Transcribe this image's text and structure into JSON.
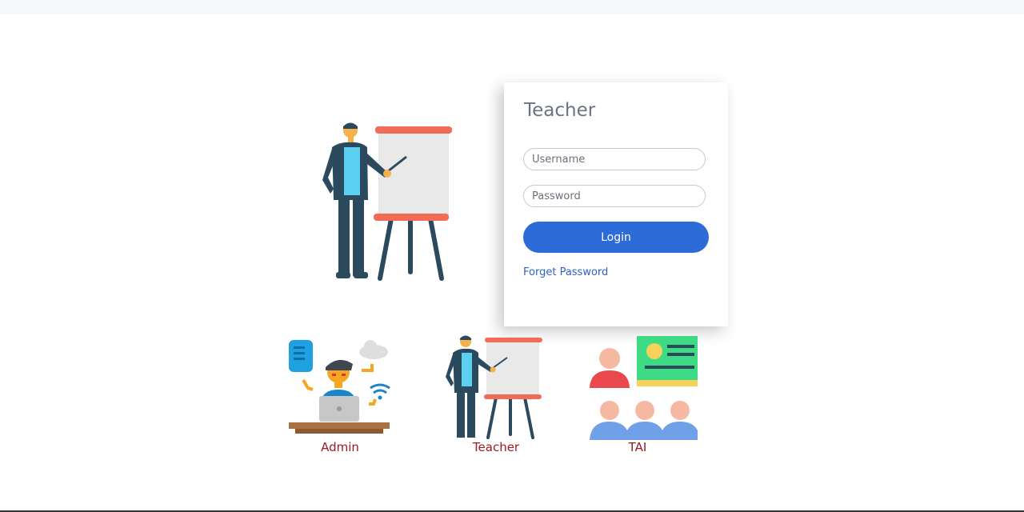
{
  "login": {
    "title": "Teacher",
    "username_placeholder": "Username",
    "password_placeholder": "Password",
    "login_label": "Login",
    "forget_label": "Forget Password"
  },
  "roles": [
    {
      "label": "Admin",
      "icon": "admin-icon"
    },
    {
      "label": "Teacher",
      "icon": "teacher-icon"
    },
    {
      "label": "TAI",
      "icon": "tai-icon"
    }
  ],
  "colors": {
    "accent": "#2d6bd8",
    "link": "#2f63c4",
    "role_label": "#9c1b23",
    "title": "#6b7385"
  }
}
